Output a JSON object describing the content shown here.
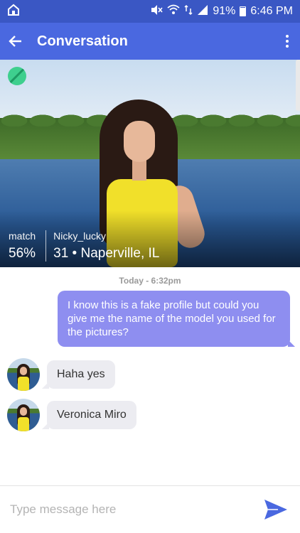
{
  "status_bar": {
    "battery": "91%",
    "time": "6:46 PM"
  },
  "app_bar": {
    "title": "Conversation"
  },
  "profile": {
    "match_label": "match",
    "match_value": "56%",
    "username": "Nicky_lucky",
    "details": "31 • Naperville, IL"
  },
  "conversation": {
    "date": "Today - 6:32pm",
    "messages": [
      {
        "direction": "outgoing",
        "text": "I know this is a fake profile but could you give me the name of the model you used for the pictures?"
      },
      {
        "direction": "incoming",
        "text": "Haha yes"
      },
      {
        "direction": "incoming",
        "text": "Veronica Miro"
      }
    ]
  },
  "composer": {
    "placeholder": "Type message here",
    "value": ""
  },
  "colors": {
    "status_bar": "#3a57c4",
    "app_bar": "#4a68e0",
    "outgoing_bubble": "#8e8ef0",
    "incoming_bubble": "#ececf1",
    "send_icon": "#4a68e0"
  }
}
